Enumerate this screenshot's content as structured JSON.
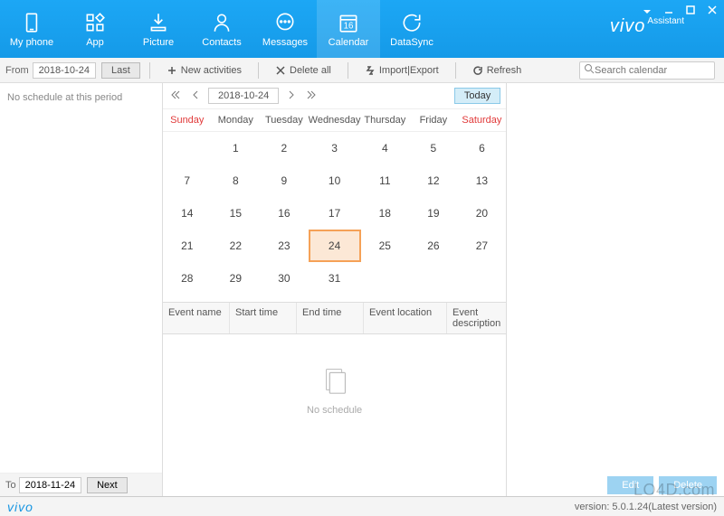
{
  "brand": {
    "name": "vivo",
    "suffix": "Assistant"
  },
  "nav": [
    {
      "id": "myphone",
      "label": "My phone"
    },
    {
      "id": "app",
      "label": "App"
    },
    {
      "id": "picture",
      "label": "Picture"
    },
    {
      "id": "contacts",
      "label": "Contacts"
    },
    {
      "id": "messages",
      "label": "Messages"
    },
    {
      "id": "calendar",
      "label": "Calendar"
    },
    {
      "id": "datasync",
      "label": "DataSync"
    }
  ],
  "toolbar": {
    "from_label": "From",
    "from_date": "2018-10-24",
    "last_btn": "Last",
    "new_btn": "New activities",
    "delete_all_btn": "Delete all",
    "import_export_btn": "Import|Export",
    "refresh_btn": "Refresh",
    "search_placeholder": "Search calendar"
  },
  "left_panel": {
    "no_schedule_msg": "No schedule at this period",
    "to_label": "To",
    "to_date": "2018-11-24",
    "next_btn": "Next"
  },
  "calendar": {
    "current_month": "2018-10-24",
    "today_btn": "Today",
    "days_of_week": [
      "Sunday",
      "Monday",
      "Tuesday",
      "Wednesday",
      "Thursday",
      "Friday",
      "Saturday"
    ],
    "first_weekday": 1,
    "days_in_month": 31,
    "today_day": 24
  },
  "events": {
    "columns": [
      "Event name",
      "Start time",
      "End time",
      "Event location",
      "Event description"
    ],
    "empty_msg": "No schedule"
  },
  "right_panel": {
    "edit_btn": "Edit",
    "delete_btn": "Delete"
  },
  "footer": {
    "logo": "vivo",
    "version": "version: 5.0.1.24(Latest version)"
  },
  "watermark": "LO4D.com",
  "colors": {
    "accent": "#1ca7f5",
    "today_border": "#f5a157",
    "weekend": "#e13a3a"
  }
}
